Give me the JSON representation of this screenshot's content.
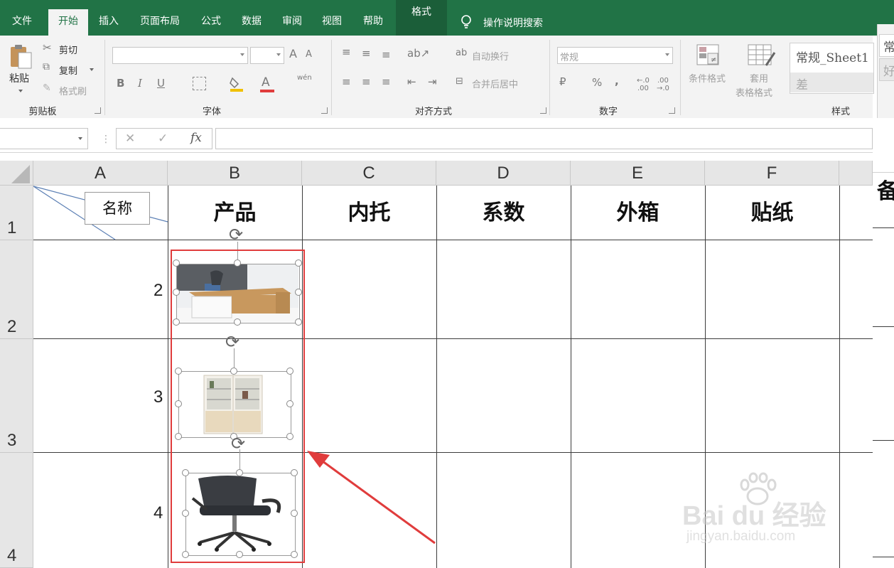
{
  "ribbon": {
    "tabs": [
      "文件",
      "开始",
      "插入",
      "页面布局",
      "公式",
      "数据",
      "审阅",
      "视图",
      "帮助",
      "格式"
    ],
    "search_label": "操作说明搜索",
    "clipboard": {
      "paste": "粘贴",
      "cut": "剪切",
      "copy": "复制",
      "format_painter": "格式刷",
      "group": "剪贴板"
    },
    "font": {
      "group": "字体",
      "bold": "B",
      "italic": "I",
      "underline": "U",
      "grow": "A",
      "shrink": "A",
      "font_color": "A",
      "phonetic": "wén"
    },
    "alignment": {
      "group": "对齐方式",
      "wrap": "自动换行",
      "merge": "合并后居中"
    },
    "number": {
      "group": "数字",
      "format": "常规",
      "percent": "%",
      "comma": ","
    },
    "styles": {
      "group": "样式",
      "cond_format": "条件格式",
      "table_format_1": "套用",
      "table_format_2": "表格格式",
      "style_normal": "常规_Sheet1",
      "style_bad": "差",
      "style_clip_1": "常",
      "style_clip_2": "好"
    }
  },
  "formula_bar": {
    "cancel": "✕",
    "enter": "✓",
    "fx": "fx",
    "value": ""
  },
  "sheet": {
    "columns": [
      "A",
      "B",
      "C",
      "D",
      "E",
      "F"
    ],
    "rows": [
      "1",
      "2",
      "3",
      "4"
    ],
    "a1_label": "名称",
    "headers": [
      "产品",
      "内托",
      "系数",
      "外箱",
      "贴纸"
    ],
    "clipped_header": "备",
    "numbers": [
      "2",
      "3",
      "4"
    ]
  },
  "watermark": {
    "brand": "Bai  du 经验",
    "url": "jingyan.baidu.com"
  },
  "colors": {
    "accent": "#217346",
    "highlight": "#e03c3c"
  }
}
